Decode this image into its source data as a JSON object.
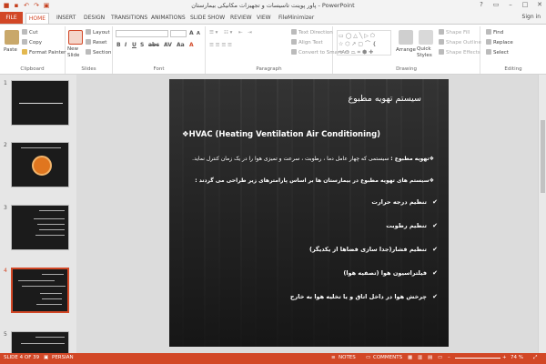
{
  "window": {
    "title": "پاور پوینت تاسیسات و تجهیزات مکانیکی بیمارستان - PowerPoint",
    "signin": "Sign in"
  },
  "tabs": [
    "FILE",
    "HOME",
    "INSERT",
    "DESIGN",
    "TRANSITIONS",
    "ANIMATIONS",
    "SLIDE SHOW",
    "REVIEW",
    "VIEW",
    "FileMinimizer"
  ],
  "ribbon": {
    "clipboard": {
      "label": "Clipboard",
      "paste": "Paste",
      "cut": "Cut",
      "copy": "Copy",
      "format_painter": "Format Painter"
    },
    "slides": {
      "label": "Slides",
      "new_slide": "New Slide",
      "layout": "Layout",
      "reset": "Reset",
      "section": "Section"
    },
    "font": {
      "label": "Font"
    },
    "paragraph": {
      "label": "Paragraph",
      "text_direction": "Text Direction",
      "align_text": "Align Text",
      "convert_smartart": "Convert to SmartArt"
    },
    "drawing": {
      "label": "Drawing",
      "arrange": "Arrange",
      "quick_styles": "Quick Styles",
      "shape_fill": "Shape Fill",
      "shape_outline": "Shape Outline",
      "shape_effects": "Shape Effects"
    },
    "editing": {
      "label": "Editing",
      "find": "Find",
      "replace": "Replace",
      "select": "Select"
    }
  },
  "thumbnails": [
    {
      "num": "1"
    },
    {
      "num": "2"
    },
    {
      "num": "3"
    },
    {
      "num": "4",
      "selected": true
    },
    {
      "num": "5"
    }
  ],
  "slide": {
    "title": "سیستم تهویه مطبوع",
    "hvac": "❖HVAC   (Heating  Ventilation Air Conditioning)",
    "para1_bold": "❖تهویه مطبوع :",
    "para1_rest": " سیستمی که چهار عامل دما ، رطوبت ، سرعت و تمیزی هوا را در یک زمان کنترل نماید.",
    "para2": "❖سیستم های تهویه مطبوع در بیمارستان ها بر اساس پارامترهای زیر طراحی می گردند :",
    "bullets": [
      "تنظیم درجه حرارت",
      "تنظیم رطوبت",
      "تنظیم فشار(جدا سازی فضاها از یکدیگر)",
      "فیلتراسیون هوا (تصفیه هوا)",
      "چرخش هوا در داخل اتاق و یا تخلیه هوا به خارج"
    ]
  },
  "status": {
    "slide": "SLIDE 4 OF 39",
    "lang": "PERSIAN",
    "notes": "NOTES",
    "comments": "COMMENTS",
    "zoom": "74 %"
  }
}
